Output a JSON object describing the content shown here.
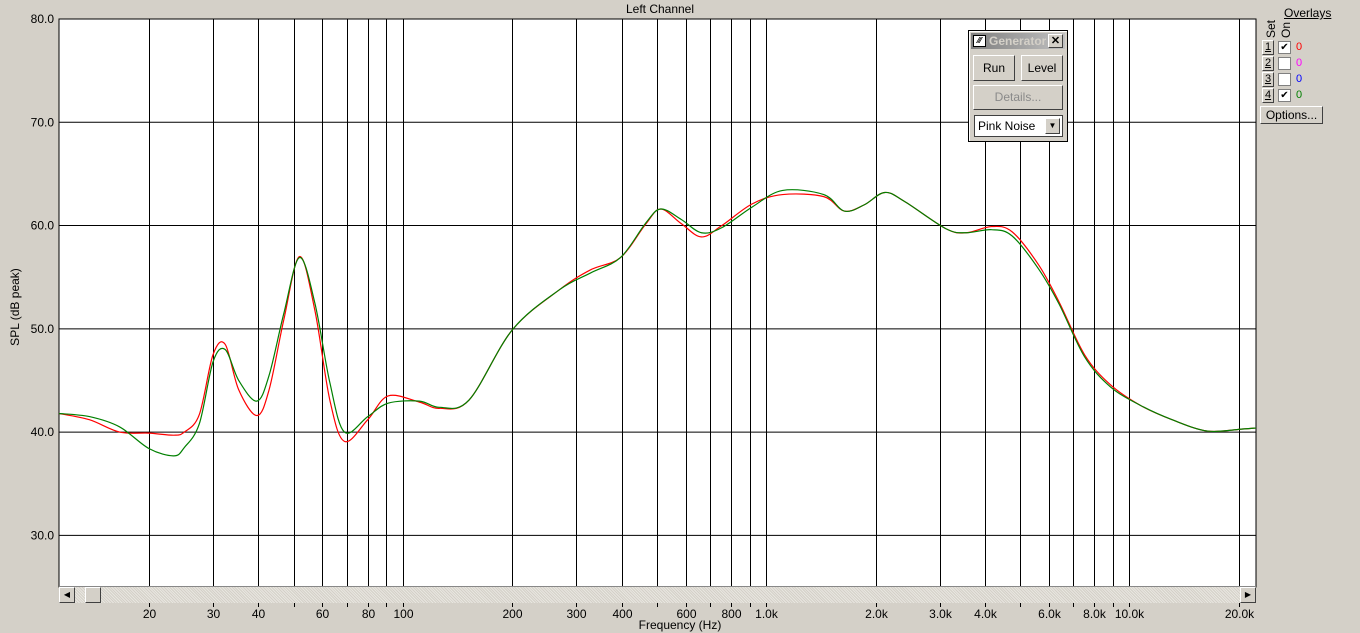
{
  "chart_data": {
    "type": "line",
    "title": "Left Channel",
    "xlabel": "Frequency (Hz)",
    "ylabel": "SPL (dB peak)",
    "x_scale": "log",
    "xlim": [
      11.3,
      22300
    ],
    "ylim": [
      25,
      80
    ],
    "grid": true,
    "y_ticks": [
      {
        "v": 80,
        "label": "80.0"
      },
      {
        "v": 70,
        "label": "70.0"
      },
      {
        "v": 60,
        "label": "60.0"
      },
      {
        "v": 50,
        "label": "50.0"
      },
      {
        "v": 40,
        "label": "40.0"
      },
      {
        "v": 30,
        "label": "30.0"
      }
    ],
    "x_ticks": [
      {
        "v": 20,
        "label": "20"
      },
      {
        "v": 30,
        "label": "30"
      },
      {
        "v": 40,
        "label": "40"
      },
      {
        "v": 50,
        "label": ""
      },
      {
        "v": 60,
        "label": "60"
      },
      {
        "v": 70,
        "label": ""
      },
      {
        "v": 80,
        "label": "80"
      },
      {
        "v": 90,
        "label": ""
      },
      {
        "v": 100,
        "label": "100"
      },
      {
        "v": 200,
        "label": "200"
      },
      {
        "v": 300,
        "label": "300"
      },
      {
        "v": 400,
        "label": "400"
      },
      {
        "v": 500,
        "label": ""
      },
      {
        "v": 600,
        "label": "600"
      },
      {
        "v": 700,
        "label": ""
      },
      {
        "v": 800,
        "label": "800"
      },
      {
        "v": 900,
        "label": ""
      },
      {
        "v": 1000,
        "label": "1.0k"
      },
      {
        "v": 2000,
        "label": "2.0k"
      },
      {
        "v": 3000,
        "label": "3.0k"
      },
      {
        "v": 4000,
        "label": "4.0k"
      },
      {
        "v": 5000,
        "label": ""
      },
      {
        "v": 6000,
        "label": "6.0k"
      },
      {
        "v": 7000,
        "label": ""
      },
      {
        "v": 8000,
        "label": "8.0k"
      },
      {
        "v": 9000,
        "label": ""
      },
      {
        "v": 10000,
        "label": "10.0k"
      },
      {
        "v": 20000,
        "label": "20.0k"
      }
    ],
    "x": [
      11.3,
      13.7,
      16.6,
      20,
      23.4,
      25,
      27.5,
      30,
      32.4,
      35.3,
      39.6,
      42.8,
      47,
      51.9,
      57.2,
      62.9,
      69,
      80,
      91,
      111,
      126,
      152,
      200,
      270,
      328,
      397,
      465,
      512,
      583,
      663,
      755,
      915,
      1110,
      1440,
      1640,
      1860,
      2120,
      2410,
      3120,
      3550,
      4170,
      4750,
      5620,
      6400,
      7520,
      8850,
      10700,
      13100,
      16400,
      20500,
      22300
    ],
    "series": [
      {
        "color": "#ff0000",
        "values": [
          41.8,
          41.2,
          40.0,
          39.9,
          39.7,
          40.0,
          41.7,
          47.5,
          48.5,
          44.1,
          41.6,
          44.1,
          50.9,
          57.0,
          51.8,
          43.1,
          39.1,
          41.2,
          43.5,
          42.9,
          42.3,
          43.1,
          49.9,
          53.8,
          55.7,
          56.9,
          60.1,
          61.6,
          60.2,
          58.9,
          60.0,
          62.1,
          63.0,
          62.8,
          61.4,
          62.0,
          63.2,
          62.3,
          59.7,
          59.3,
          59.9,
          59.4,
          56.2,
          52.6,
          47.5,
          44.6,
          42.6,
          41.2,
          40.1,
          40.3,
          40.4
        ]
      },
      {
        "color": "#008000",
        "values": [
          41.8,
          41.5,
          40.5,
          38.4,
          37.7,
          38.5,
          40.8,
          46.8,
          48.0,
          45.0,
          43.0,
          45.5,
          51.5,
          56.9,
          52.5,
          44.8,
          40.0,
          41.5,
          42.8,
          43.0,
          42.4,
          43.1,
          49.9,
          53.8,
          55.4,
          56.9,
          60.2,
          61.6,
          60.6,
          59.3,
          59.8,
          61.8,
          63.4,
          63.0,
          61.4,
          62.0,
          63.2,
          62.3,
          59.7,
          59.3,
          59.6,
          59.0,
          55.8,
          52.4,
          47.3,
          44.4,
          42.6,
          41.2,
          40.1,
          40.3,
          40.4
        ]
      }
    ]
  },
  "generator": {
    "title": "Generator",
    "icon": "waveform-icon",
    "run": "Run",
    "level": "Level",
    "details": "Details...",
    "signal": "Pink Noise"
  },
  "overlays": {
    "title": "Overlays",
    "set_label": "Set",
    "on_label": "On",
    "options": "Options...",
    "rows": [
      {
        "set": "1",
        "on": true,
        "count": "0",
        "color": "#ff0000"
      },
      {
        "set": "2",
        "on": false,
        "count": "0",
        "color": "#ff00ff"
      },
      {
        "set": "3",
        "on": false,
        "count": "0",
        "color": "#0000ff"
      },
      {
        "set": "4",
        "on": true,
        "count": "0",
        "color": "#008000"
      }
    ]
  }
}
